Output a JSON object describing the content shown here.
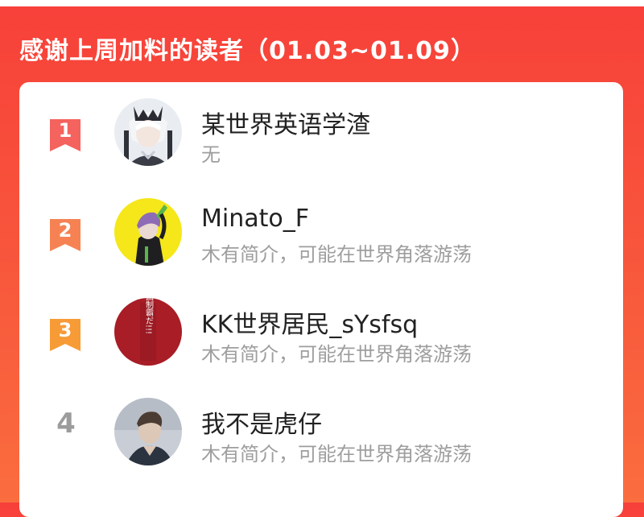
{
  "header": {
    "title": "感谢上周加料的读者（01.03~01.09）"
  },
  "ranking": [
    {
      "rank": "1",
      "name": "某世界英语学渣",
      "desc": "无",
      "badge_color": "#f4635e"
    },
    {
      "rank": "2",
      "name": "Minato_F",
      "desc": "木有简介，可能在世界角落游荡",
      "badge_color": "#f68253"
    },
    {
      "rank": "3",
      "name": "KK世界居民_sYsfsq",
      "desc": "木有简介，可能在世界角落游荡",
      "badge_color": "#f79b36"
    },
    {
      "rank": "4",
      "name": "我不是虎仔",
      "desc": "木有简介，可能在世界角落游荡"
    }
  ],
  "avatar_text": {
    "kk": "全国制霸だ!!!"
  },
  "colors": {
    "accent": "#f7403a",
    "name_text": "#222222",
    "desc_text": "#9e9e9e"
  }
}
